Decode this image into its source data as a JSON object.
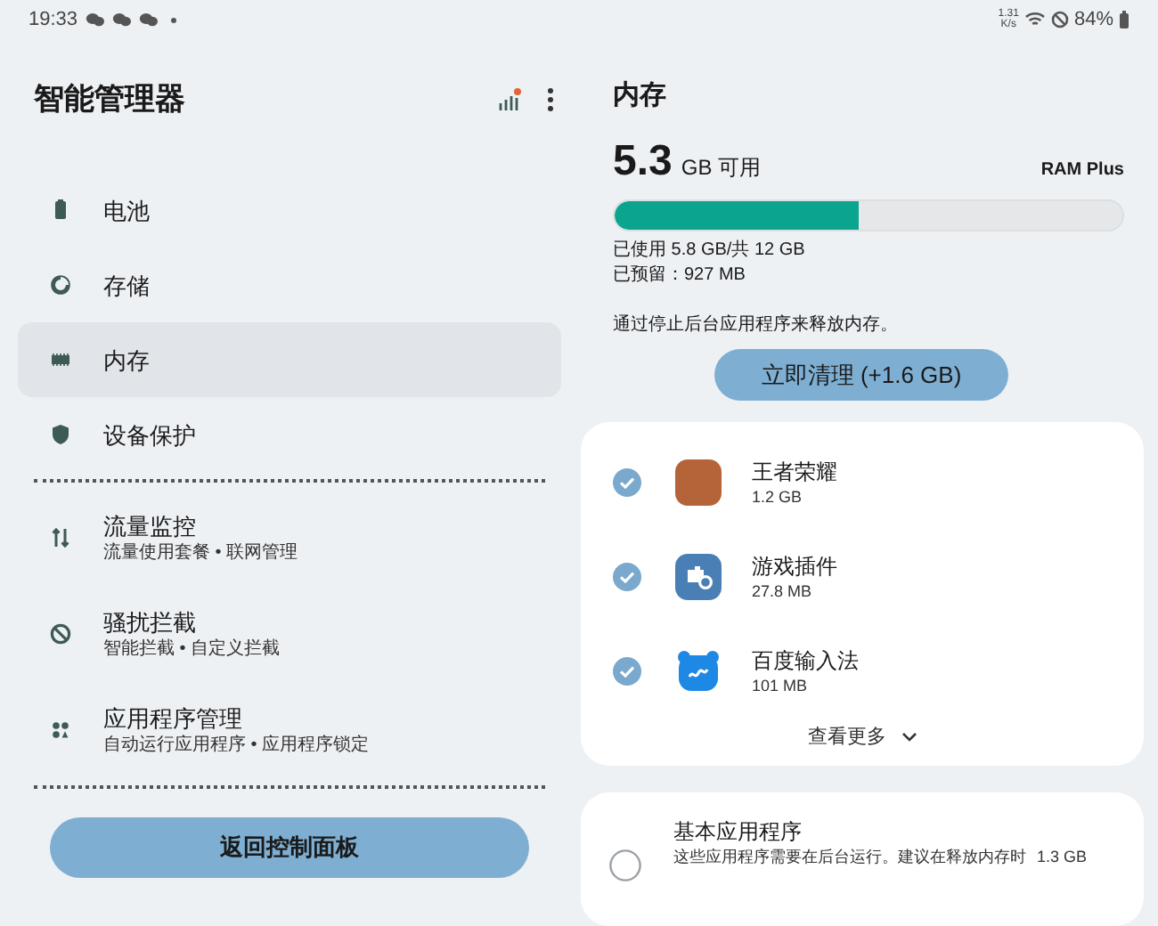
{
  "status_bar": {
    "time": "19:33",
    "notification_icons": [
      {
        "kind": "chat"
      },
      {
        "kind": "chat"
      },
      {
        "kind": "chat"
      }
    ],
    "speed_value": "1.31",
    "speed_unit": "K/s",
    "battery": "84%"
  },
  "sidebar": {
    "title": "智能管理器",
    "items": [
      {
        "kind": "battery",
        "label": "电池",
        "selected": false
      },
      {
        "kind": "storage",
        "label": "存储",
        "selected": false
      },
      {
        "kind": "memory",
        "label": "内存",
        "selected": true
      },
      {
        "kind": "shield",
        "label": "设备保护",
        "selected": false
      },
      {
        "kind": "divider"
      },
      {
        "kind": "data",
        "label": "流量监控",
        "subtitle": "流量使用套餐 • 联网管理",
        "selected": false
      },
      {
        "kind": "block",
        "label": "骚扰拦截",
        "subtitle": "智能拦截 • 自定义拦截",
        "selected": false
      },
      {
        "kind": "apps",
        "label": "应用程序管理",
        "subtitle": "自动运行应用程序 • 应用程序锁定",
        "selected": false
      },
      {
        "kind": "divider"
      }
    ],
    "back_button": "返回控制面板"
  },
  "memory": {
    "title": "内存",
    "available_value": "5.3",
    "available_unit": "GB 可用",
    "ram_plus": "RAM Plus",
    "level": 0.48,
    "used": "已使用 5.8 GB/共 12 GB",
    "reserved": "已预留：927 MB",
    "hint": "通过停止后台应用程序来释放内存。",
    "clean_button": "立即清理 (+1.6 GB)",
    "apps": [
      {
        "kind": "game",
        "name": "王者荣耀",
        "size": "1.2 GB",
        "checked": true
      },
      {
        "kind": "plugin",
        "name": "游戏插件",
        "size": "27.8 MB",
        "checked": true
      },
      {
        "kind": "keyboard",
        "name": "百度输入法",
        "size": "101 MB",
        "checked": true
      }
    ],
    "see_more": "查看更多",
    "essential": {
      "title": "基本应用程序",
      "description": "这些应用程序需要在后台运行。建议在释放内存时",
      "size": "1.3 GB",
      "checked": false
    }
  }
}
